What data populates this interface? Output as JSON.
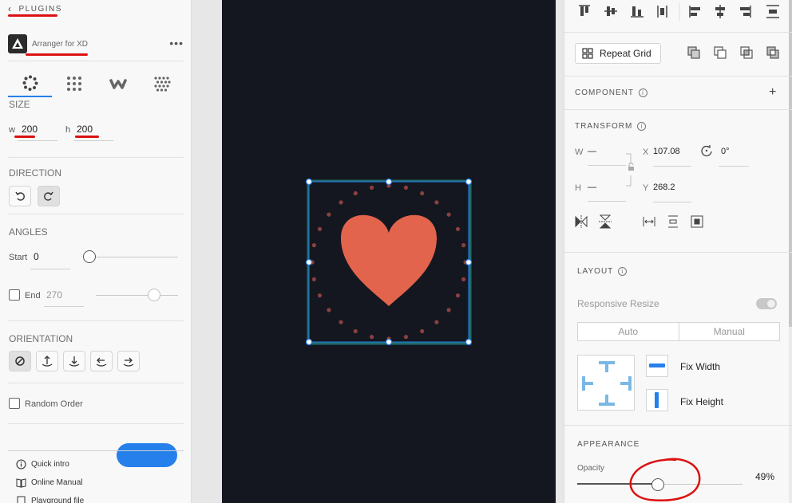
{
  "left": {
    "header": "PLUGINS",
    "plugin_name": "Arranger for XD",
    "more": "•••",
    "size": {
      "title": "SIZE",
      "w_label": "w",
      "w_value": "200",
      "h_label": "h",
      "h_value": "200"
    },
    "direction": {
      "title": "DIRECTION"
    },
    "angles": {
      "title": "ANGLES",
      "start_label": "Start",
      "start_value": "0",
      "end_label": "End",
      "end_value": "270"
    },
    "orientation": {
      "title": "ORIENTATION"
    },
    "random_order": "Random Order",
    "links": [
      "Quick intro",
      "Online Manual",
      "Playground file"
    ]
  },
  "right": {
    "repeat_grid": "Repeat Grid",
    "component": "COMPONENT",
    "add": "+",
    "transform": {
      "title": "TRANSFORM",
      "w_label": "W",
      "w_value": "—",
      "h_label": "H",
      "h_value": "—",
      "x_label": "X",
      "x_value": "107.08",
      "y_label": "Y",
      "y_value": "268.2",
      "rotation": "0°"
    },
    "layout": {
      "title": "LAYOUT",
      "responsive": "Responsive Resize",
      "auto": "Auto",
      "manual": "Manual",
      "fix_width": "Fix Width",
      "fix_height": "Fix Height"
    },
    "appearance": {
      "title": "APPEARANCE",
      "opacity_label": "Opacity",
      "opacity_value": "49%",
      "opacity_level": 0.49
    }
  },
  "colors": {
    "accent": "#2680eb",
    "heart": "#e2644d",
    "canvas": "#14171f",
    "dots": "#8a4040",
    "annotation": "#d11111"
  },
  "info_glyph": "i"
}
